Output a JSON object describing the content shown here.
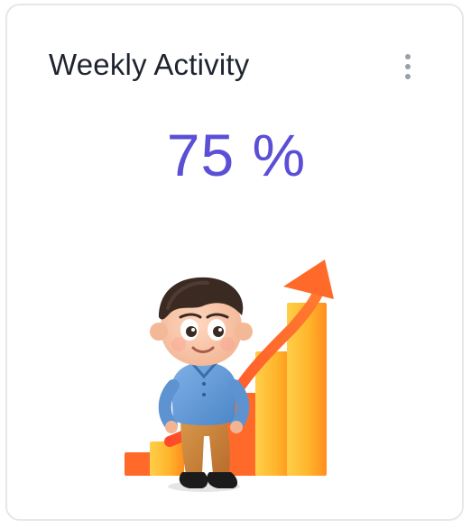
{
  "card": {
    "title": "Weekly Activity",
    "value": "75 %",
    "menu_icon": "kebab-vertical-icon",
    "illustration": "boy-with-growth-chart-illustration"
  },
  "colors": {
    "accent": "#5b4fd6",
    "title": "#1f2430",
    "bars": "#ffb52b",
    "arrow": "#ff6a2b"
  }
}
